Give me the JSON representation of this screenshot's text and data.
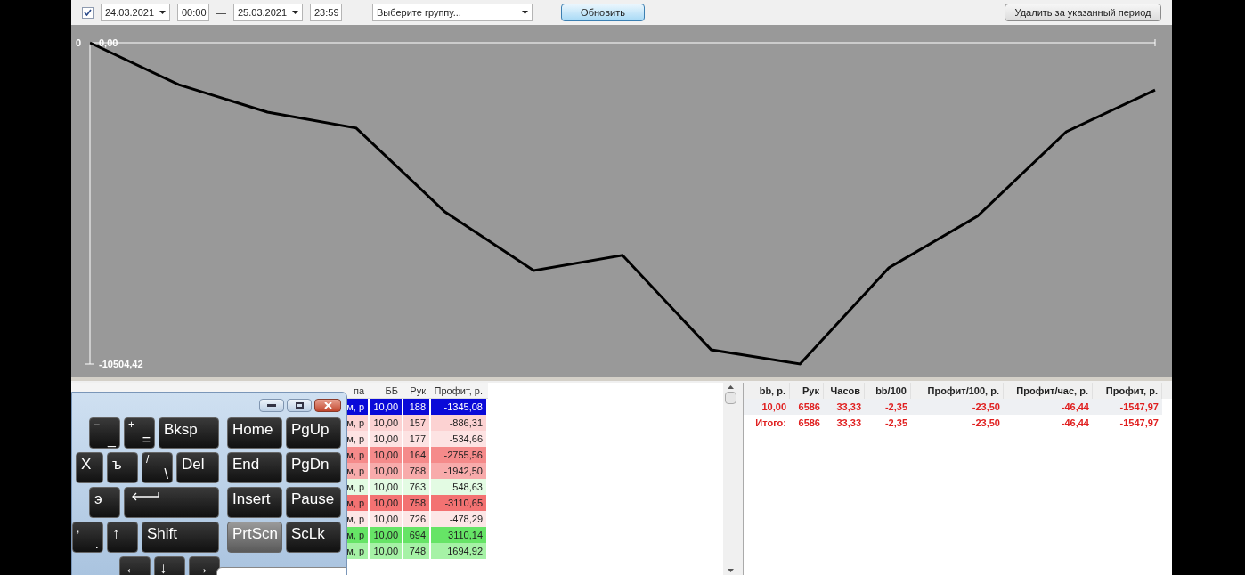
{
  "toolbar": {
    "period_checkbox": {
      "checked": true
    },
    "date_from": "24.03.2021",
    "time_from": "00:00",
    "separator": "—",
    "date_to": "25.03.2021",
    "time_to": "23:59",
    "group_select": "Выберите группу...",
    "refresh_button": "Обновить",
    "delete_button": "Удалить за указанный период"
  },
  "chart": {
    "x_axis_label": "0",
    "chart_data": {
      "type": "line",
      "series": [
        {
          "color": "#000000",
          "values": [
            0,
            -1370,
            -2270,
            -2790,
            -5530,
            -7450,
            -6950,
            -10040,
            -10504.42,
            -7360,
            -5670,
            -2910,
            -1547.97
          ]
        }
      ],
      "ylim": [
        -10504.42,
        0
      ],
      "yticks": [
        {
          "value": 0,
          "label": "0,00"
        },
        {
          "value": -10504.42,
          "label": "-10504,42"
        }
      ]
    }
  },
  "hands_table": {
    "columns": [
      "па",
      "ББ",
      "Рук",
      "Профит, р."
    ],
    "rows": [
      {
        "cells": [
          "м, р",
          "10,00",
          "188",
          "-1345,08"
        ],
        "color": "#0a0ad8",
        "selected": true
      },
      {
        "cells": [
          "м, р",
          "10,00",
          "157",
          "-886,31"
        ],
        "color": "#fcd2d2",
        "selected": false
      },
      {
        "cells": [
          "м, р",
          "10,00",
          "177",
          "-534,66"
        ],
        "color": "#fde3e3",
        "selected": false
      },
      {
        "cells": [
          "м, р",
          "10,00",
          "164",
          "-2755,56"
        ],
        "color": "#f58a8a",
        "selected": false
      },
      {
        "cells": [
          "м, р",
          "10,00",
          "788",
          "-1942,50"
        ],
        "color": "#f8abab",
        "selected": false
      },
      {
        "cells": [
          "м, р",
          "10,00",
          "763",
          "548,63"
        ],
        "color": "#e3fbe3",
        "selected": false
      },
      {
        "cells": [
          "м, р",
          "10,00",
          "758",
          "-3110,65"
        ],
        "color": "#f37272",
        "selected": false
      },
      {
        "cells": [
          "м, р",
          "10,00",
          "726",
          "-478,29"
        ],
        "color": "#fde6e6",
        "selected": false
      },
      {
        "cells": [
          "м, р",
          "10,00",
          "694",
          "3110,14"
        ],
        "color": "#66e466",
        "selected": false
      },
      {
        "cells": [
          "м, р",
          "10,00",
          "748",
          "1694,92"
        ],
        "color": "#a6f2a6",
        "selected": false
      }
    ]
  },
  "keyboard": {
    "rows": [
      {
        "keys": [
          {
            "kind": "dual",
            "upper": "−",
            "lower": "_",
            "hovered": false
          },
          {
            "kind": "dual",
            "upper": "+",
            "lower": "=",
            "hovered": false
          },
          {
            "kind": "wide",
            "label": "Bksp",
            "hovered": false
          }
        ],
        "nav": [
          {
            "kind": "nav",
            "label": "Home",
            "hovered": false
          },
          {
            "kind": "nav",
            "label": "PgUp",
            "hovered": false
          }
        ]
      },
      {
        "keys": [
          {
            "kind": "narrow",
            "label": "X",
            "hovered": false
          },
          {
            "kind": "normal",
            "label": "ъ",
            "hovered": false
          },
          {
            "kind": "dual",
            "upper": "/",
            "lower": "\\",
            "hovered": false
          },
          {
            "kind": "medium",
            "label": "Del",
            "hovered": false
          }
        ],
        "nav": [
          {
            "kind": "nav",
            "label": "End",
            "hovered": false
          },
          {
            "kind": "nav",
            "label": "PgDn",
            "hovered": false
          }
        ]
      },
      {
        "keys": [
          {
            "kind": "normal",
            "label": "э",
            "hovered": false
          },
          {
            "kind": "enter",
            "hovered": false
          }
        ],
        "nav": [
          {
            "kind": "nav",
            "label": "Insert",
            "hovered": false
          },
          {
            "kind": "nav",
            "label": "Pause",
            "hovered": false
          }
        ]
      },
      {
        "keys": [
          {
            "kind": "dual",
            "upper": ",",
            "lower": ".",
            "hovered": false
          },
          {
            "kind": "normal",
            "label": "↑",
            "hovered": false
          },
          {
            "kind": "shift",
            "label": "Shift",
            "hovered": false
          }
        ],
        "nav": [
          {
            "kind": "nav",
            "label": "PrtScn",
            "hovered": true
          },
          {
            "kind": "nav",
            "label": "ScLk",
            "hovered": false
          }
        ]
      },
      {
        "keys": [
          {
            "kind": "normal",
            "label": "←",
            "hovered": false
          },
          {
            "kind": "normal",
            "label": "↓",
            "hovered": false
          },
          {
            "kind": "normal",
            "label": "→",
            "hovered": false
          }
        ],
        "nav": []
      }
    ]
  },
  "summary_table": {
    "columns": [
      "bb, р.",
      "Рук",
      "Часов",
      "bb/100",
      "Профит/100, р.",
      "Профит/час, р.",
      "Профит, р."
    ],
    "rows": [
      {
        "cells": [
          "10,00",
          "6586",
          "33,33",
          "-2,35",
          "-23,50",
          "-46,44",
          "-1547,97"
        ],
        "selected": true
      },
      {
        "cells": [
          "Итого:",
          "6586",
          "33,33",
          "-2,35",
          "-23,50",
          "-46,44",
          "-1547,97"
        ],
        "selected": false
      }
    ]
  }
}
